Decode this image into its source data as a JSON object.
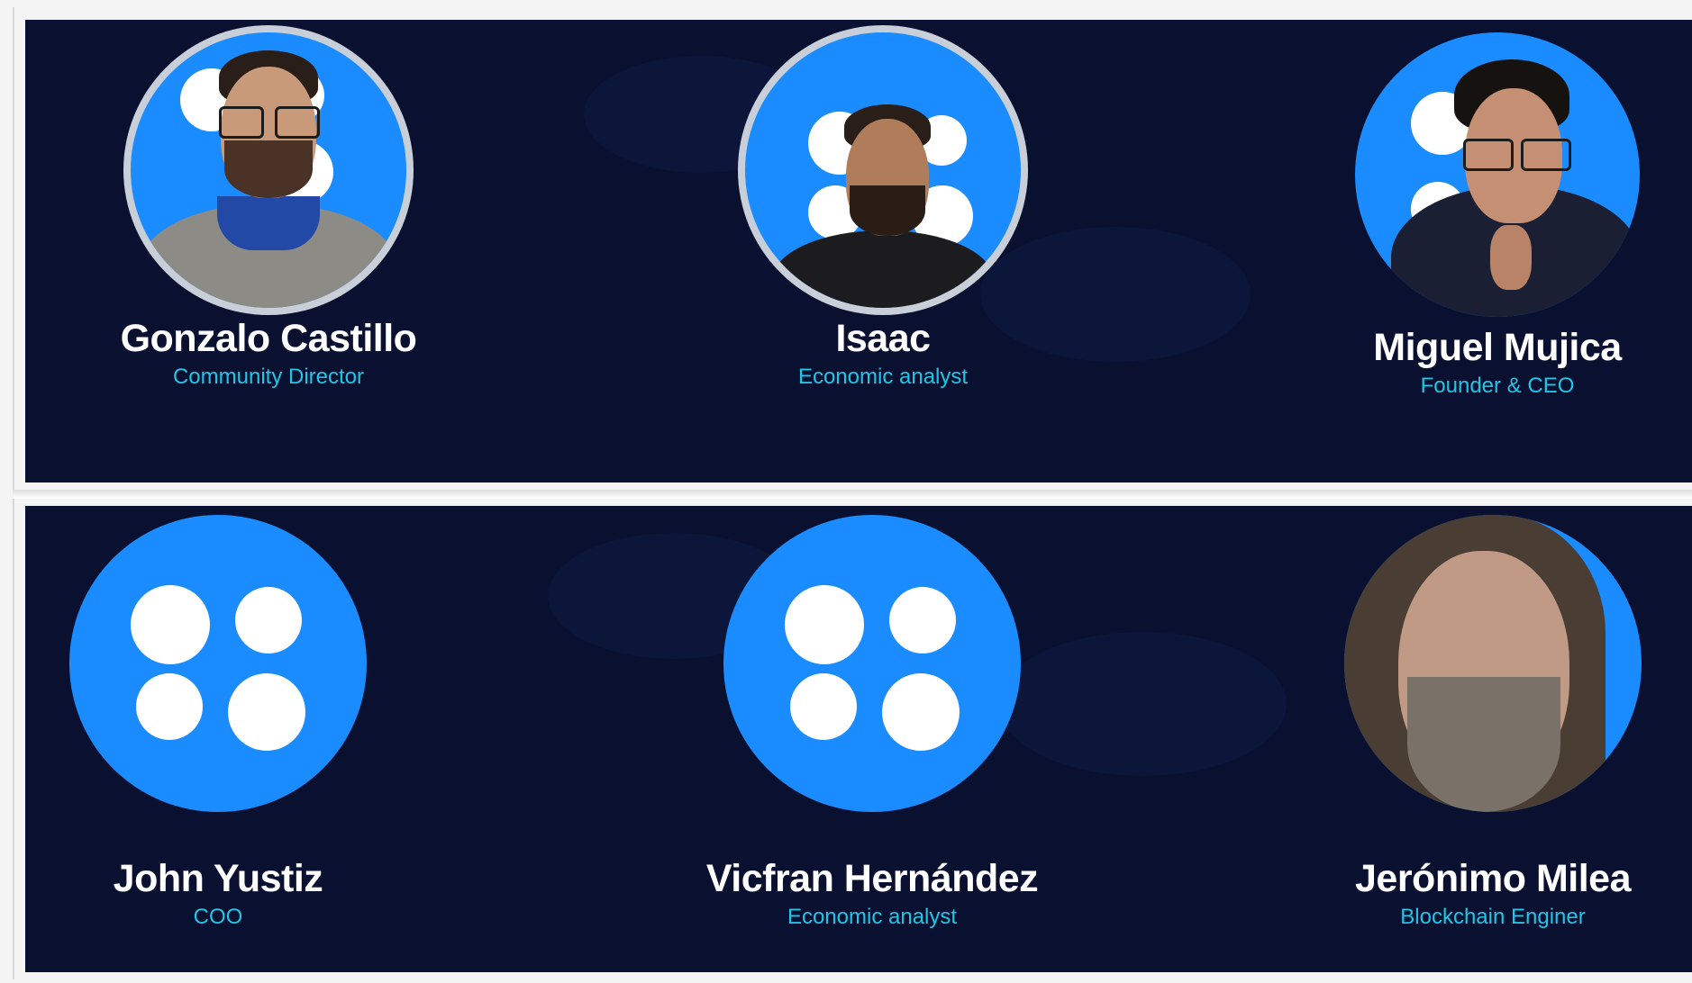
{
  "team": {
    "row1": [
      {
        "name": "Gonzalo Castillo",
        "role": "Community Director",
        "avatar": "photo-man-glasses"
      },
      {
        "name": "Isaac",
        "role": "Economic analyst",
        "avatar": "photo-man-beard"
      },
      {
        "name": "Miguel Mujica",
        "role": "Founder & CEO",
        "avatar": "photo-man-hoodie"
      }
    ],
    "row2": [
      {
        "name": "John Yustiz",
        "role": "COO",
        "avatar": "logo-four-dots"
      },
      {
        "name": "Vicfran Hernández",
        "role": "Economic analyst",
        "avatar": "logo-four-dots"
      },
      {
        "name": "Jerónimo Milea",
        "role": "Blockchain Enginer",
        "avatar": "photo-man-long-hair"
      }
    ]
  },
  "colors": {
    "background": "#0a1130",
    "accent": "#1a8cff",
    "role_text": "#22c4e6",
    "name_text": "#ffffff"
  }
}
